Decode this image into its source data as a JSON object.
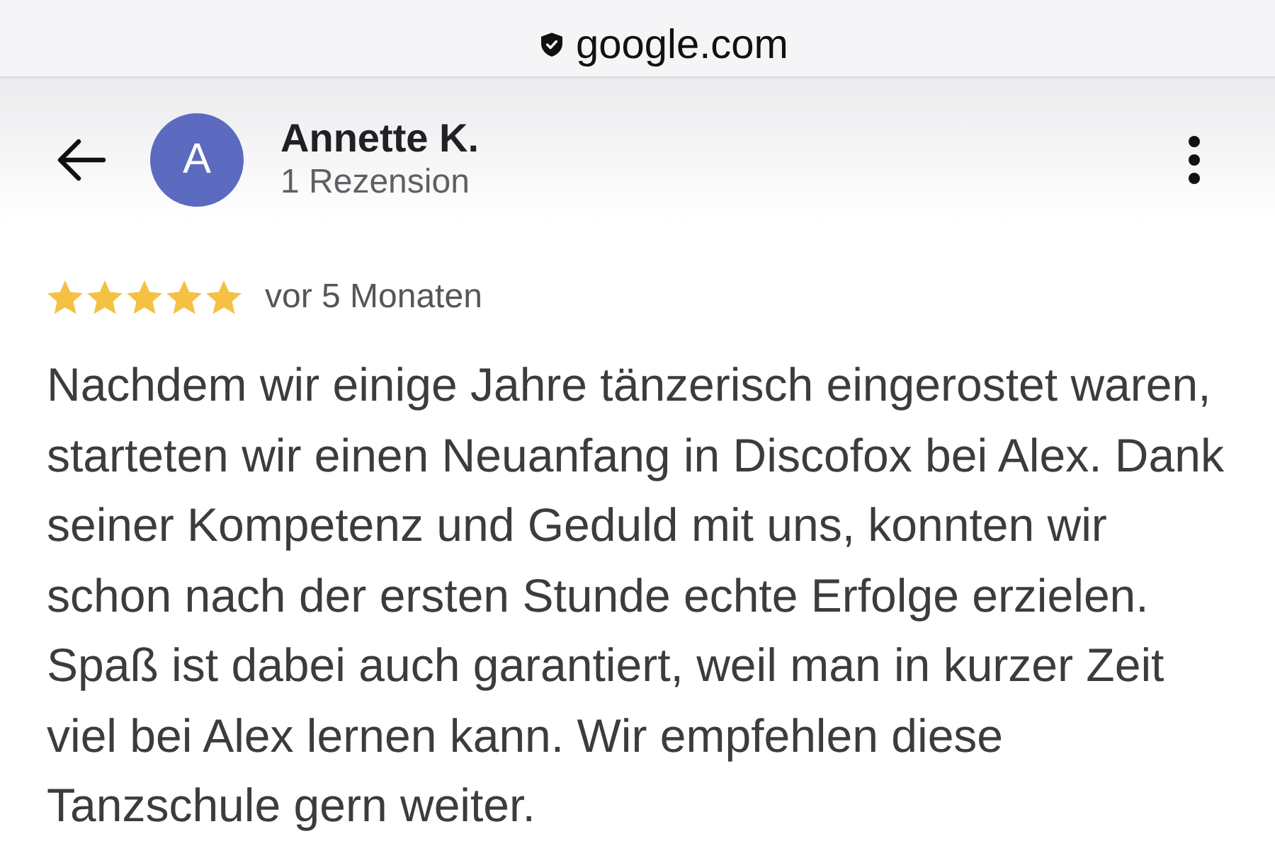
{
  "address_bar": {
    "url": "google.com",
    "secure": true
  },
  "header": {
    "avatar_letter": "A",
    "name": "Annette K.",
    "subtitle": "1 Rezension"
  },
  "review": {
    "stars": 5,
    "time": "vor 5 Monaten",
    "text": "Nachdem wir einige Jahre tänzerisch eingerostet waren, starteten wir einen Neuanfang in Discofox bei Alex. Dank seiner Kompetenz und Geduld mit uns, konnten wir schon nach der ersten Stunde echte Erfolge erzielen. Spaß ist dabei auch garantiert, weil man in kurzer Zeit viel bei Alex lernen kann. Wir empfehlen diese Tanzschule gern weiter."
  }
}
